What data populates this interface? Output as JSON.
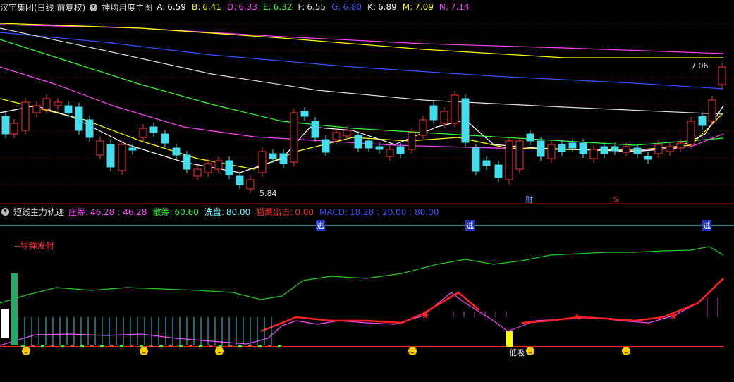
{
  "header": {
    "stock_title": "汉宇集团(日线 前复权)",
    "indicator_name": "神均月度主图",
    "values": [
      {
        "label": "A:",
        "value": "6.59",
        "color": "#ffffff"
      },
      {
        "label": "B:",
        "value": "6.41",
        "color": "#ffff00"
      },
      {
        "label": "D:",
        "value": "6.33",
        "color": "#ff44ff"
      },
      {
        "label": "E:",
        "value": "6.32",
        "color": "#33ff33"
      },
      {
        "label": "F:",
        "value": "6.55",
        "color": "#dddddd"
      },
      {
        "label": "G:",
        "value": "6.80",
        "color": "#3355ff"
      },
      {
        "label": "K:",
        "value": "6.89",
        "color": "#ffffff"
      },
      {
        "label": "M:",
        "value": "7.09",
        "color": "#ffff00"
      },
      {
        "label": "N:",
        "value": "7.14",
        "color": "#ff44ff"
      }
    ]
  },
  "main_chart": {
    "high_label": "7.06",
    "low_label": "5.84",
    "markers": [
      {
        "text": "财",
        "color": "#66aaff"
      },
      {
        "text": "$",
        "color": "#ff3333"
      }
    ]
  },
  "indicator": {
    "name": "短线主力轨迹",
    "values": [
      {
        "label": "庄筹:",
        "value": "46.28 : 46.28",
        "color": "#ff44ff"
      },
      {
        "label": "散筹:",
        "value": "60.60",
        "color": "#33ff33"
      },
      {
        "label": "洗盘:",
        "value": "80.00",
        "color": "#66ffff"
      },
      {
        "label": "猎鹰出击:",
        "value": "0.00",
        "color": "#ff3333"
      },
      {
        "label": "MACD:",
        "value": "18.28 : 20.00 : 80.00",
        "color": "#3355ff"
      }
    ],
    "escape_label": "逃",
    "missile_label": "--导弹发射",
    "low_buy_label": "低吸"
  },
  "colors": {
    "up": "#ff3333",
    "down": "#44ddee",
    "grid": "#8b0000"
  }
}
